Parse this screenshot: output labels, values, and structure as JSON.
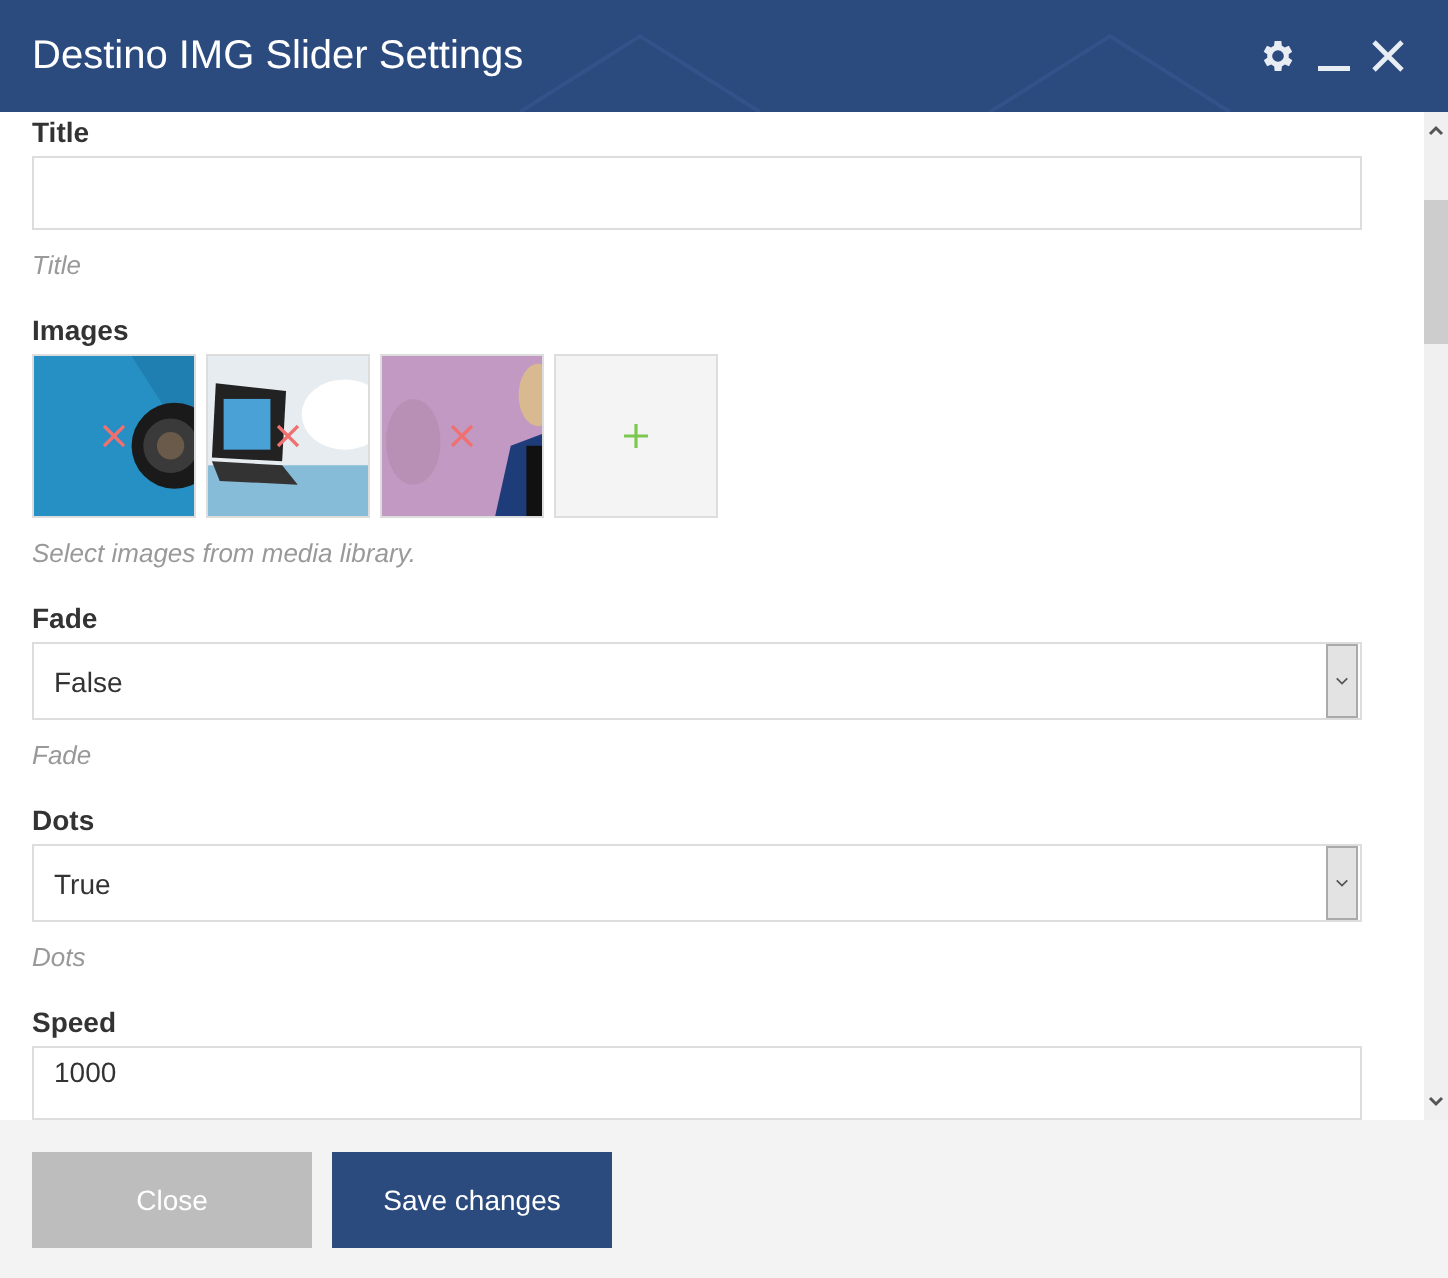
{
  "window": {
    "title": "Destino IMG Slider Settings"
  },
  "fields": [
    {
      "kind": "text",
      "label": "Title",
      "help": "Title"
    },
    {
      "kind": "images",
      "label": "Images",
      "help": "Select images from media library."
    },
    {
      "kind": "select",
      "label": "Fade",
      "value": "False",
      "help": "Fade"
    },
    {
      "kind": "select",
      "label": "Dots",
      "value": "True",
      "help": "Dots"
    },
    {
      "kind": "text",
      "label": "Speed",
      "value": "1000"
    }
  ],
  "buttons": [
    {
      "label": "Close",
      "kind": "secondary"
    },
    {
      "label": "Save changes",
      "kind": "primary"
    }
  ]
}
